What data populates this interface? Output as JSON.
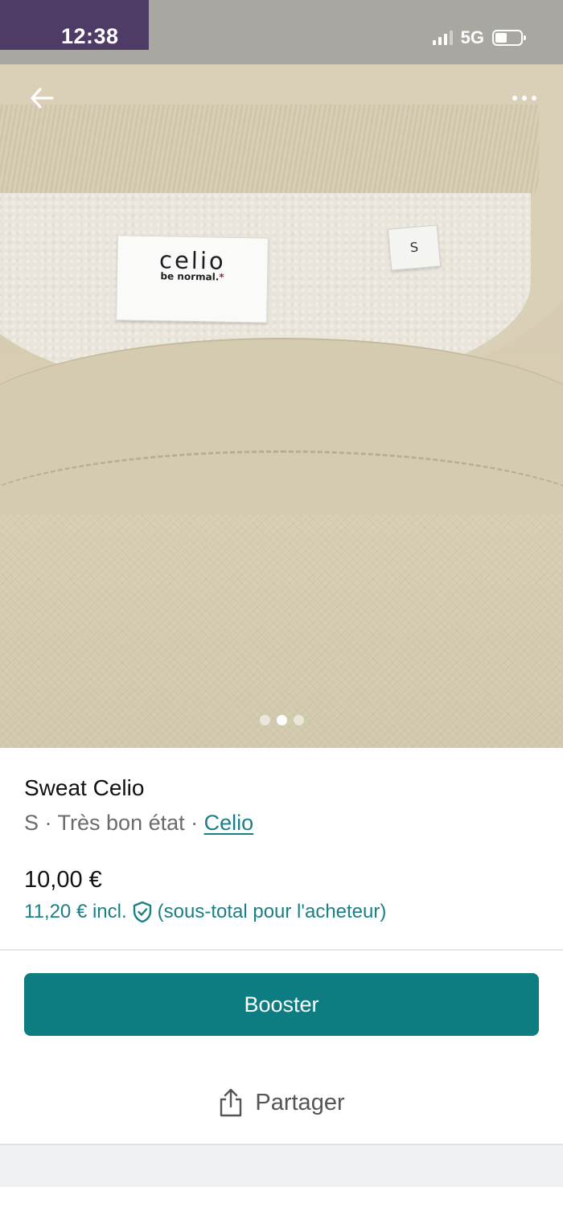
{
  "status_bar": {
    "time": "12:38",
    "network": "5G",
    "signal_bars": 3,
    "battery_level": 0.4
  },
  "nav": {
    "back_icon": "arrow-left-icon",
    "more_icon": "more-horizontal-icon"
  },
  "photo": {
    "label_brand": "celio",
    "label_tagline": "be normal.",
    "label_tagline_mark": "*",
    "size_tag": "S",
    "image_count": 3,
    "current_index": 2
  },
  "item": {
    "title": "Sweat Celio",
    "size": "S",
    "separator": " · ",
    "condition": "Très bon état",
    "brand": "Celio",
    "price": "10,00 €",
    "price_incl": "11,20 € incl.",
    "price_incl_note": "(sous-total pour l'acheteur)",
    "protection_icon": "shield-check-icon"
  },
  "actions": {
    "booster_label": "Booster",
    "share_label": "Partager",
    "share_icon": "share-icon"
  },
  "colors": {
    "accent": "#0d7d82",
    "link": "#1a7f86",
    "text_primary": "#111111",
    "text_secondary": "#6b6b6b"
  }
}
